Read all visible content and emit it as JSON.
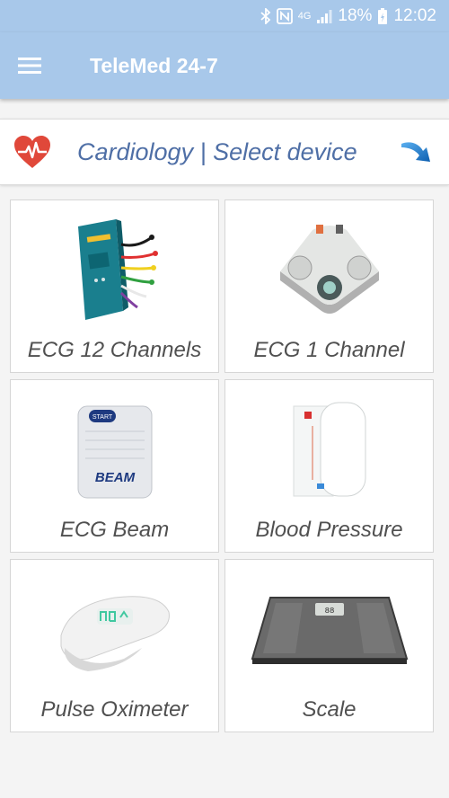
{
  "status_bar": {
    "network": "4G",
    "battery": "18%",
    "time": "12:02"
  },
  "app_bar": {
    "title": "TeleMed 24-7"
  },
  "header": {
    "text": "Cardiology | Select device"
  },
  "devices": [
    {
      "label": "ECG 12 Channels"
    },
    {
      "label": "ECG 1 Channel"
    },
    {
      "label": "ECG Beam"
    },
    {
      "label": "Blood Pressure"
    },
    {
      "label": "Pulse Oximeter"
    },
    {
      "label": "Scale"
    }
  ],
  "device_badges": {
    "beam_start": "START",
    "beam_logo": "BEAM",
    "scale_display": "88"
  },
  "colors": {
    "bar": "#a8c8ea",
    "accent_text": "#4f6fa6",
    "heart": "#e0483a",
    "arrow": "#1f7fd0"
  }
}
